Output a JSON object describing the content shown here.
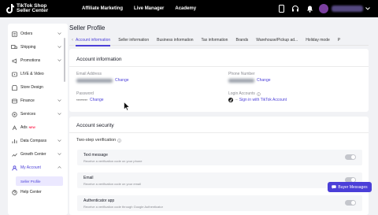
{
  "topbar": {
    "logo_line1": "TikTok Shop",
    "logo_line2": "Seller Center",
    "nav": [
      "Affiliate Marketing",
      "Live Manager",
      "Academy"
    ]
  },
  "sidebar": {
    "items": [
      {
        "label": "Orders",
        "icon": "orders-icon"
      },
      {
        "label": "Shipping",
        "icon": "truck-icon"
      },
      {
        "label": "Promotions",
        "icon": "megaphone-icon"
      },
      {
        "label": "LIVE & Video",
        "icon": "video-icon"
      },
      {
        "label": "Store Design",
        "icon": "store-icon"
      },
      {
        "label": "Finance",
        "icon": "finance-icon"
      },
      {
        "label": "Services",
        "icon": "services-icon"
      },
      {
        "label": "Ads",
        "icon": "ads-icon",
        "badge": "NEW"
      },
      {
        "label": "Data Compass",
        "icon": "compass-icon"
      },
      {
        "label": "Growth Center",
        "icon": "growth-icon"
      },
      {
        "label": "My Account",
        "icon": "account-icon"
      },
      {
        "label": "Help Center",
        "icon": "help-icon"
      }
    ],
    "active_sub": "Seller Profile"
  },
  "page": {
    "title": "Seller Profile",
    "tabs": [
      "Account information",
      "Seller information",
      "Business information",
      "Tax information",
      "Brands",
      "Warehouse/Pickup ad...",
      "Holiday mode",
      "P"
    ]
  },
  "account_info": {
    "title": "Account information",
    "email_label": "Email Address",
    "phone_label": "Phone Number",
    "password_label": "Password",
    "password_value": "********",
    "login_label": "Login Accounts",
    "change": "Change",
    "sign_in_tiktok": "Sign in with TikTok Account"
  },
  "security": {
    "title": "Account security",
    "two_step": "Two-step verification",
    "rows": [
      {
        "title": "Text message",
        "desc": "Receive a verification code on your phone"
      },
      {
        "title": "Email",
        "desc": "Receive a verification code on your email"
      },
      {
        "title": "Authenticator app",
        "desc": "Receive a verification code through Google Authenticator"
      }
    ]
  },
  "buyer_messages": "Buyer Messages",
  "colors": {
    "accent": "#4b3fd8",
    "topbar": "#000000",
    "page_bg": "#f1f2f5"
  }
}
